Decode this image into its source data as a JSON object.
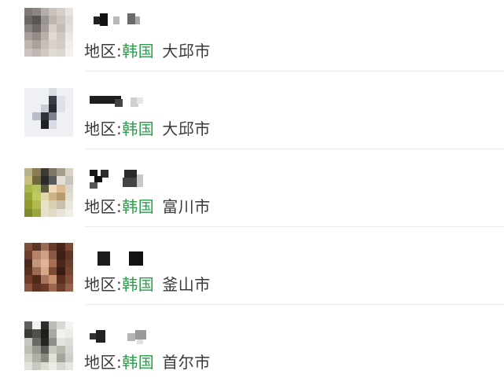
{
  "contacts": [
    {
      "region_label": "地区:",
      "country": "韩国",
      "city": "大邱市",
      "avatar_colors": [
        "#7f7a78",
        "#8c8582",
        "#b5ada8",
        "#c9c2bd",
        "#d4cec9",
        "#e6e3e0",
        "#6d6865",
        "#5a5553",
        "#9a948f",
        "#bcb5b0",
        "#cbc4bf",
        "#dedad6",
        "#8a8380",
        "#6e6966",
        "#a39c97",
        "#d7cfc9",
        "#c2bbb6",
        "#e4dfdb",
        "#a69f9a",
        "#938c87",
        "#b8b0aa",
        "#e0d8d2",
        "#cfc8c3",
        "#ebe7e4",
        "#bdb6b1",
        "#a8a19c",
        "#c6beb8",
        "#d9d1cb",
        "#d2cbc6",
        "#efecea",
        "#cbc4bf",
        "#bfb8b3",
        "#d1c9c3",
        "#e2dbd5",
        "#dcd6d1",
        "#f3f1ef"
      ]
    },
    {
      "region_label": "地区:",
      "country": "韩国",
      "city": "大邱市",
      "avatar_colors": [
        "#eef0f4",
        "#eef0f4",
        "#eef0f4",
        "#d9dbe2",
        "#eef0f4",
        "#eef0f4",
        "#eef0f4",
        "#eef0f4",
        "#eef0f4",
        "#3a3d45",
        "#e0e2e8",
        "#eef0f4",
        "#eef0f4",
        "#eef0f4",
        "#c9ccd4",
        "#2a2c33",
        "#dfe1e6",
        "#eef0f4",
        "#eef0f4",
        "#b8bcc6",
        "#2f3138",
        "#7e8290",
        "#eef0f4",
        "#eef0f4",
        "#eef0f4",
        "#eef0f4",
        "#1f2026",
        "#d8dbe1",
        "#eef0f4",
        "#eef0f4",
        "#eef0f4",
        "#eef0f4",
        "#eef0f4",
        "#eef0f4",
        "#eef0f4",
        "#eef0f4"
      ]
    },
    {
      "region_label": "地区:",
      "country": "韩国",
      "city": "富川市",
      "avatar_colors": [
        "#b9b18a",
        "#8b7b55",
        "#3f3a30",
        "#7d7566",
        "#a49d8a",
        "#d7d2c3",
        "#c8c07c",
        "#6e6a3c",
        "#2c2a26",
        "#5a5a5e",
        "#e3dfd6",
        "#c9c4b7",
        "#aab54a",
        "#b7c25a",
        "#5b5a3a",
        "#f0d8bd",
        "#ddb990",
        "#dad5ca",
        "#98a23b",
        "#c0c860",
        "#e0d6a6",
        "#cbb387",
        "#b79a6e",
        "#e3ddd1",
        "#8f9a2f",
        "#b2ba4c",
        "#e9e3c5",
        "#d8d0b0",
        "#c8c0a8",
        "#ebe6db",
        "#7e8a2a",
        "#9aa53b",
        "#e7e1c9",
        "#e1dac5",
        "#e9e4d9",
        "#f1eee7"
      ]
    },
    {
      "region_label": "地区:",
      "country": "韩国",
      "city": "釜山市",
      "avatar_colors": [
        "#7d4e3a",
        "#5b3324",
        "#9a6a52",
        "#6a3a28",
        "#4a2618",
        "#7a4a36",
        "#6d3f2c",
        "#b48268",
        "#d0a080",
        "#8a5a44",
        "#3f2015",
        "#5e3526",
        "#4c2a1d",
        "#c49578",
        "#e0b496",
        "#a86e52",
        "#4a2719",
        "#6a3e2c",
        "#5a3020",
        "#9c6a50",
        "#d8a888",
        "#7e4a34",
        "#3a1d12",
        "#754632",
        "#6e3d2a",
        "#4e2a1c",
        "#a8765c",
        "#c89272",
        "#5a2f20",
        "#824f3a",
        "#8a5640",
        "#5e3324",
        "#6a3a2a",
        "#9a664c",
        "#6e3c2a",
        "#946048"
      ]
    },
    {
      "region_label": "地区:",
      "country": "韩国",
      "city": "首尔市",
      "avatar_colors": [
        "#5e5e5a",
        "#f2f2f0",
        "#2d2d2b",
        "#bdbdb8",
        "#d8d8d4",
        "#f3f3f1",
        "#3a3a37",
        "#4f4f4c",
        "#1e1e1c",
        "#a9a9a4",
        "#f1f1ef",
        "#ecece9",
        "#c7c7c2",
        "#6a6a66",
        "#262624",
        "#8e8e89",
        "#e3e3df",
        "#dcdcd8",
        "#bdbdb5",
        "#9a9a93",
        "#5c5c57",
        "#c8c8c0",
        "#b6b6ad",
        "#d6d6d0",
        "#d1d1c9",
        "#b0b0a6",
        "#8a8a82",
        "#e0e0da",
        "#a4a49a",
        "#cfcfc8",
        "#e2e2dc",
        "#c9c9c1",
        "#dcdcd5",
        "#ecece7",
        "#d7d7d0",
        "#e6e6e0"
      ]
    }
  ]
}
